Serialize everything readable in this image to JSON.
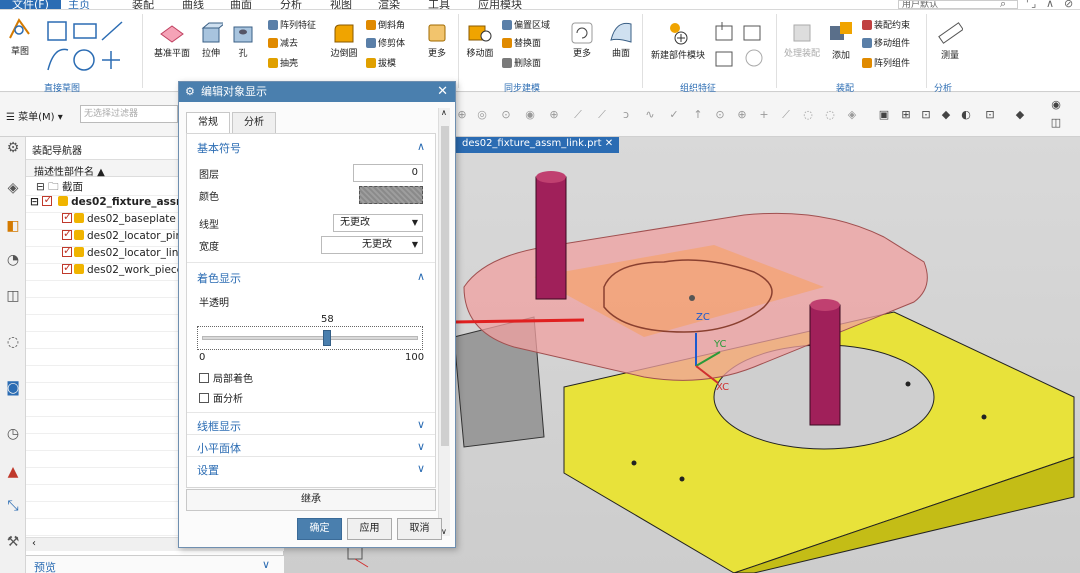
{
  "menubar": {
    "tabs": [
      "文件(F)",
      "主页",
      "装配",
      "曲线",
      "曲面",
      "分析",
      "视图",
      "渲染",
      "工具",
      "应用模块"
    ],
    "active_tab": "主页",
    "user_field": "用户默认"
  },
  "ribbon": {
    "sketch": {
      "label": "草图",
      "group": "直接草图"
    },
    "feature": {
      "datum": "基准平面",
      "extrude": "拉伸",
      "hole": "孔",
      "pattern": "阵列特征",
      "subtract": "减去",
      "shell": "抽壳",
      "blend": "边倒圆",
      "chamfer": "倒斜角",
      "trim": "修剪体",
      "draft": "拔模",
      "more": "更多"
    },
    "sync": {
      "move_face": "移动面",
      "offset_region": "偏置区域",
      "replace_face": "替换面",
      "delete_face": "删除面",
      "more": "更多",
      "group": "同步建模"
    },
    "surface": {
      "label": "曲面"
    },
    "assembly": {
      "new_component": "新建部件模块",
      "group_org": "组织特征",
      "process_assy": "处理装配",
      "add": "添加",
      "constraint": "装配约束",
      "move_component": "移动组件",
      "pattern_component": "阵列组件",
      "group": "装配"
    },
    "analysis": {
      "measure": "测量",
      "group": "分析"
    }
  },
  "toolbar2": {
    "menu_label": "菜单(M) ▾",
    "filter_placeholder": "无选择过滤器"
  },
  "navigator": {
    "title": "装配导航器",
    "column_header": "描述性部件名 ▲",
    "rows": [
      {
        "label": "截面"
      },
      {
        "label": "des02_fixture_assm"
      },
      {
        "label": "des02_baseplate"
      },
      {
        "label": "des02_locator_pir"
      },
      {
        "label": "des02_locator_lin"
      },
      {
        "label": "des02_work_piece"
      }
    ],
    "preview": "预览"
  },
  "graphics": {
    "file_tab": "des02_fixture_assm_link.prt",
    "axis_labels": {
      "zc": "ZC",
      "yc": "YC",
      "xc": "XC"
    }
  },
  "dialog": {
    "title": "编辑对象显示",
    "tabs": [
      "常规",
      "分析"
    ],
    "section_basic": "基本符号",
    "layer_label": "图层",
    "layer_value": "0",
    "color_label": "颜色",
    "linetype_label": "线型",
    "linetype_value": "无更改",
    "width_label": "宽度",
    "width_value": "无更改",
    "section_shading": "着色显示",
    "translucency_label": "半透明",
    "slider": {
      "value": "58",
      "min": "0",
      "max": "100",
      "fraction": 0.58
    },
    "partial_shading": "局部着色",
    "face_analysis": "面分析",
    "section_wireframe": "线框显示",
    "section_facets": "小平面体",
    "section_settings": "设置",
    "inherit": "继承",
    "ok": "确定",
    "apply": "应用",
    "cancel": "取消"
  },
  "colors": {
    "accent": "#2b6cb3",
    "dialog_title": "#4a7fae",
    "baseplate": "#e8e23a",
    "workpiece": "#f0a0a0",
    "pin": "#a0205a",
    "arrow": "#e02020"
  }
}
